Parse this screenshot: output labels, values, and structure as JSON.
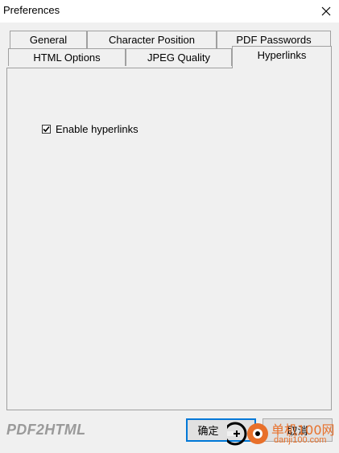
{
  "window": {
    "title": "Preferences"
  },
  "tabs": {
    "row_back": [
      "General",
      "Character Position",
      "PDF Passwords"
    ],
    "row_front": [
      "HTML Options",
      "JPEG Quality",
      "Hyperlinks"
    ],
    "active": "Hyperlinks"
  },
  "hyperlinks": {
    "enable_label": "Enable hyperlinks",
    "enable_checked": true
  },
  "footer": {
    "brand": "PDF2HTML",
    "ok_label": "确定",
    "cancel_label": "取消"
  },
  "watermark": {
    "site_name": "单机100网",
    "site_url": "danji100.com"
  },
  "colors": {
    "accent": "#0078d7",
    "watermark": "#e8702a"
  }
}
